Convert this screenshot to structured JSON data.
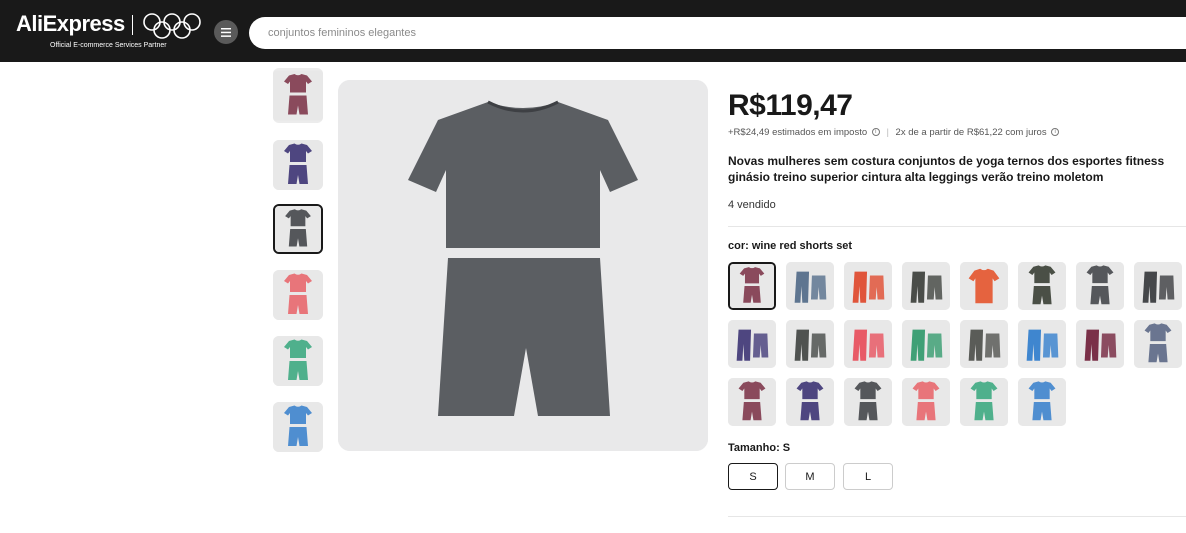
{
  "header": {
    "logo_text": "AliExpress",
    "partner_text": "Official E-commerce Services Partner",
    "search_placeholder": "conjuntos femininos elegantes"
  },
  "thumbnails": [
    {
      "color": "#8a4a5c",
      "type": "shorts-set"
    },
    {
      "color": "#4e4680",
      "type": "shorts-set"
    },
    {
      "color": "#55575b",
      "type": "shorts-set",
      "selected": true
    },
    {
      "color": "#e8757a",
      "type": "shorts-set"
    },
    {
      "color": "#4fb08c",
      "type": "shorts-set"
    },
    {
      "color": "#4f8ed0",
      "type": "shorts-set"
    }
  ],
  "main_image": {
    "color": "#5b5e62",
    "background": "#e9e9ea"
  },
  "product": {
    "price": "R$119,47",
    "tax_text": "+R$24,49 estimados em imposto",
    "installments_text": "2x de a partir de R$61,22 com juros",
    "title": "Novas mulheres sem costura conjuntos de yoga ternos dos esportes fitness ginásio treino superior cintura alta leggings verão treino moletom",
    "sold": "4 vendido"
  },
  "color_selector": {
    "label": "cor: wine red shorts set",
    "options": [
      {
        "color": "#8a4a5c",
        "type": "shorts-set",
        "selected": true
      },
      {
        "color": "#5e7590",
        "type": "leggings"
      },
      {
        "color": "#e0553b",
        "type": "leggings"
      },
      {
        "color": "#4a4d49",
        "type": "leggings"
      },
      {
        "color": "#e5633f",
        "type": "tee"
      },
      {
        "color": "#4a4f46",
        "type": "shorts-set"
      },
      {
        "color": "#55575b",
        "type": "shorts-set"
      },
      {
        "color": "#45474a",
        "type": "leggings"
      },
      {
        "color": "#4e4680",
        "type": "leggings"
      },
      {
        "color": "#4f5250",
        "type": "leggings"
      },
      {
        "color": "#e85a66",
        "type": "leggings"
      },
      {
        "color": "#3fa076",
        "type": "leggings"
      },
      {
        "color": "#5a5c58",
        "type": "leggings"
      },
      {
        "color": "#3f86cf",
        "type": "leggings"
      },
      {
        "color": "#7a3048",
        "type": "leggings"
      },
      {
        "color": "#6a7590",
        "type": "shorts-set"
      },
      {
        "color": "#8a4a5c",
        "type": "shorts-set"
      },
      {
        "color": "#4e4680",
        "type": "shorts-set"
      },
      {
        "color": "#55575b",
        "type": "shorts-set"
      },
      {
        "color": "#e8757a",
        "type": "shorts-set"
      },
      {
        "color": "#4fb08c",
        "type": "shorts-set"
      },
      {
        "color": "#4f8ed0",
        "type": "shorts-set"
      }
    ]
  },
  "size_selector": {
    "label": "Tamanho: S",
    "options": [
      {
        "label": "S",
        "selected": true
      },
      {
        "label": "M"
      },
      {
        "label": "L"
      }
    ]
  }
}
